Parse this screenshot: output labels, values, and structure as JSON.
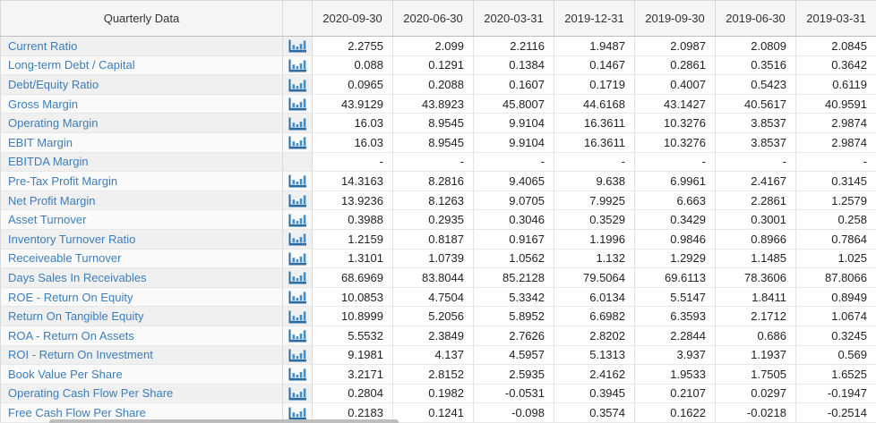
{
  "table": {
    "title": "Quarterly Data",
    "columns": [
      "2020-09-30",
      "2020-06-30",
      "2020-03-31",
      "2019-12-31",
      "2019-09-30",
      "2019-06-30",
      "2019-03-31"
    ],
    "rows": [
      {
        "label": "Current Ratio",
        "has_chart_icon": true,
        "values": [
          "2.2755",
          "2.099",
          "2.2116",
          "1.9487",
          "2.0987",
          "2.0809",
          "2.0845"
        ]
      },
      {
        "label": "Long-term Debt / Capital",
        "has_chart_icon": true,
        "values": [
          "0.088",
          "0.1291",
          "0.1384",
          "0.1467",
          "0.2861",
          "0.3516",
          "0.3642"
        ]
      },
      {
        "label": "Debt/Equity Ratio",
        "has_chart_icon": true,
        "values": [
          "0.0965",
          "0.2088",
          "0.1607",
          "0.1719",
          "0.4007",
          "0.5423",
          "0.6119"
        ]
      },
      {
        "label": "Gross Margin",
        "has_chart_icon": true,
        "values": [
          "43.9129",
          "43.8923",
          "45.8007",
          "44.6168",
          "43.1427",
          "40.5617",
          "40.9591"
        ]
      },
      {
        "label": "Operating Margin",
        "has_chart_icon": true,
        "values": [
          "16.03",
          "8.9545",
          "9.9104",
          "16.3611",
          "10.3276",
          "3.8537",
          "2.9874"
        ]
      },
      {
        "label": "EBIT Margin",
        "has_chart_icon": true,
        "values": [
          "16.03",
          "8.9545",
          "9.9104",
          "16.3611",
          "10.3276",
          "3.8537",
          "2.9874"
        ]
      },
      {
        "label": "EBITDA Margin",
        "has_chart_icon": false,
        "values": [
          "-",
          "-",
          "-",
          "-",
          "-",
          "-",
          "-"
        ]
      },
      {
        "label": "Pre-Tax Profit Margin",
        "has_chart_icon": true,
        "values": [
          "14.3163",
          "8.2816",
          "9.4065",
          "9.638",
          "6.9961",
          "2.4167",
          "0.3145"
        ]
      },
      {
        "label": "Net Profit Margin",
        "has_chart_icon": true,
        "values": [
          "13.9236",
          "8.1263",
          "9.0705",
          "7.9925",
          "6.663",
          "2.2861",
          "1.2579"
        ]
      },
      {
        "label": "Asset Turnover",
        "has_chart_icon": true,
        "values": [
          "0.3988",
          "0.2935",
          "0.3046",
          "0.3529",
          "0.3429",
          "0.3001",
          "0.258"
        ]
      },
      {
        "label": "Inventory Turnover Ratio",
        "has_chart_icon": true,
        "values": [
          "1.2159",
          "0.8187",
          "0.9167",
          "1.1996",
          "0.9846",
          "0.8966",
          "0.7864"
        ]
      },
      {
        "label": "Receiveable Turnover",
        "has_chart_icon": true,
        "values": [
          "1.3101",
          "1.0739",
          "1.0562",
          "1.132",
          "1.2929",
          "1.1485",
          "1.025"
        ]
      },
      {
        "label": "Days Sales In Receivables",
        "has_chart_icon": true,
        "values": [
          "68.6969",
          "83.8044",
          "85.2128",
          "79.5064",
          "69.6113",
          "78.3606",
          "87.8066"
        ]
      },
      {
        "label": "ROE - Return On Equity",
        "has_chart_icon": true,
        "values": [
          "10.0853",
          "4.7504",
          "5.3342",
          "6.0134",
          "5.5147",
          "1.8411",
          "0.8949"
        ]
      },
      {
        "label": "Return On Tangible Equity",
        "has_chart_icon": true,
        "values": [
          "10.8999",
          "5.2056",
          "5.8952",
          "6.6982",
          "6.3593",
          "2.1712",
          "1.0674"
        ]
      },
      {
        "label": "ROA - Return On Assets",
        "has_chart_icon": true,
        "values": [
          "5.5532",
          "2.3849",
          "2.7626",
          "2.8202",
          "2.2844",
          "0.686",
          "0.3245"
        ]
      },
      {
        "label": "ROI - Return On Investment",
        "has_chart_icon": true,
        "values": [
          "9.1981",
          "4.137",
          "4.5957",
          "5.1313",
          "3.937",
          "1.1937",
          "0.569"
        ]
      },
      {
        "label": "Book Value Per Share",
        "has_chart_icon": true,
        "values": [
          "3.2171",
          "2.8152",
          "2.5935",
          "2.4162",
          "1.9533",
          "1.7505",
          "1.6525"
        ]
      },
      {
        "label": "Operating Cash Flow Per Share",
        "has_chart_icon": true,
        "values": [
          "0.2804",
          "0.1982",
          "-0.0531",
          "0.3945",
          "0.2107",
          "0.0297",
          "-0.1947"
        ]
      },
      {
        "label": "Free Cash Flow Per Share",
        "has_chart_icon": true,
        "values": [
          "0.2183",
          "0.1241",
          "-0.098",
          "0.3574",
          "0.1622",
          "-0.0218",
          "-0.2514"
        ]
      }
    ]
  },
  "icons": {
    "chart_icon": "bar-chart-icon"
  },
  "colors": {
    "link_blue": "#3d7dba",
    "icon_axis_blue": "#2d6ca2",
    "icon_bar_blue": "#3f8fc9",
    "header_bg": "#f5f5f5",
    "row_odd_bg": "#f0f0f0",
    "row_even_bg": "#fafafa",
    "header_border": "#bdbdbd",
    "cell_border": "#e2e2e2",
    "column_border": "#d9d9d9",
    "scrollbar_thumb": "#bdbdbd"
  }
}
